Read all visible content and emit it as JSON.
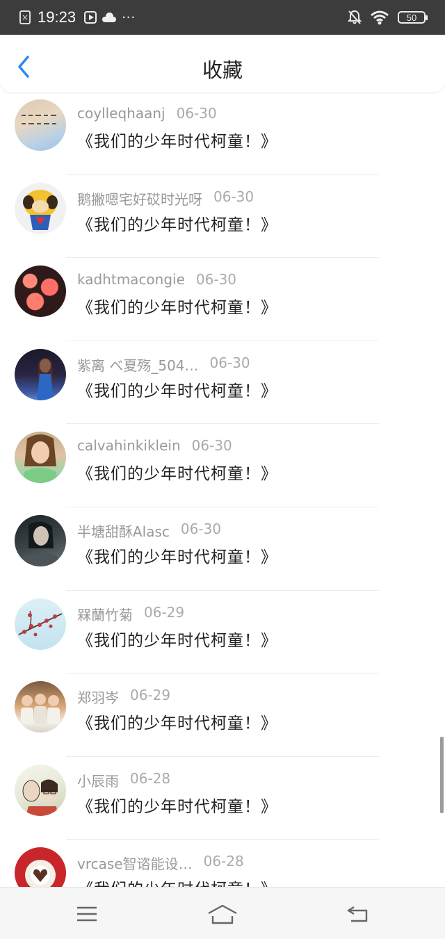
{
  "status_bar": {
    "time": "19:23",
    "notification_box": "×",
    "dots": "···",
    "battery": "50"
  },
  "header": {
    "title": "收藏",
    "accent_color": "#2a8bf2"
  },
  "favorites": [
    {
      "name": "coylleqhaanj",
      "date": "06-30",
      "title": "《我们的少年时代柯童！》"
    },
    {
      "name": "鹅撇嗯宅好砹时光呀",
      "date": "06-30",
      "title": "《我们的少年时代柯童！》"
    },
    {
      "name": "kadhtmacongie",
      "date": "06-30",
      "title": "《我们的少年时代柯童！》"
    },
    {
      "name": "紫离 べ夏殇_504…",
      "date": "06-30",
      "title": "《我们的少年时代柯童！》"
    },
    {
      "name": "calvahinkiklein",
      "date": "06-30",
      "title": "《我们的少年时代柯童！》"
    },
    {
      "name": "半塘甜酥Alasc",
      "date": "06-30",
      "title": "《我们的少年时代柯童！》"
    },
    {
      "name": "槑蘭竹菊",
      "date": "06-29",
      "title": "《我们的少年时代柯童！》"
    },
    {
      "name": "郑羽岑",
      "date": "06-29",
      "title": "《我们的少年时代柯童！》"
    },
    {
      "name": "小辰雨",
      "date": "06-28",
      "title": "《我们的少年时代柯童！》"
    },
    {
      "name": "vrcase智谘能设…",
      "date": "06-28",
      "title": "《我们的少年时代柯童！》"
    }
  ],
  "nav": {
    "icons": [
      "menu-icon",
      "home-icon",
      "back-icon"
    ]
  }
}
